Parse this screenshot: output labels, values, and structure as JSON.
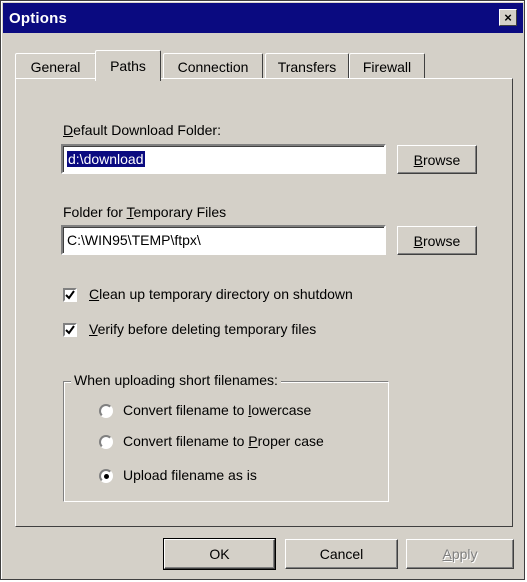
{
  "window": {
    "title": "Options",
    "close_glyph": "×"
  },
  "tabs": [
    {
      "label": "General",
      "active": false
    },
    {
      "label": "Paths",
      "active": true
    },
    {
      "label": "Connection",
      "active": false
    },
    {
      "label": "Transfers",
      "active": false
    },
    {
      "label": "Firewall",
      "active": false
    }
  ],
  "download": {
    "label_pre": "",
    "label_mnemonic": "D",
    "label_post": "efault Download Folder:",
    "value": "d:\\download",
    "browse_pre": "",
    "browse_mnemonic": "B",
    "browse_post": "rowse"
  },
  "temp": {
    "label_pre": "Folder for ",
    "label_mnemonic": "T",
    "label_post": "emporary Files",
    "value": "C:\\WIN95\\TEMP\\ftpx\\",
    "browse_pre": "",
    "browse_mnemonic": "B",
    "browse_post": "rowse"
  },
  "checkboxes": [
    {
      "pre": "",
      "mnemonic": "C",
      "post": "lean up temporary directory on shutdown",
      "checked": true
    },
    {
      "pre": "",
      "mnemonic": "V",
      "post": "erify before deleting temporary files",
      "checked": true
    }
  ],
  "group": {
    "label": "When uploading short filenames:",
    "options": [
      {
        "pre": "Convert filename to ",
        "mnemonic": "l",
        "post": "owercase",
        "selected": false
      },
      {
        "pre": "Convert filename to ",
        "mnemonic": "P",
        "post": "roper case",
        "selected": false
      },
      {
        "pre": "Upload filename as is",
        "mnemonic": "",
        "post": "",
        "selected": true
      }
    ]
  },
  "buttons": {
    "ok": "OK",
    "cancel": "Cancel",
    "apply_pre": "",
    "apply_mnemonic": "A",
    "apply_post": "pply"
  }
}
